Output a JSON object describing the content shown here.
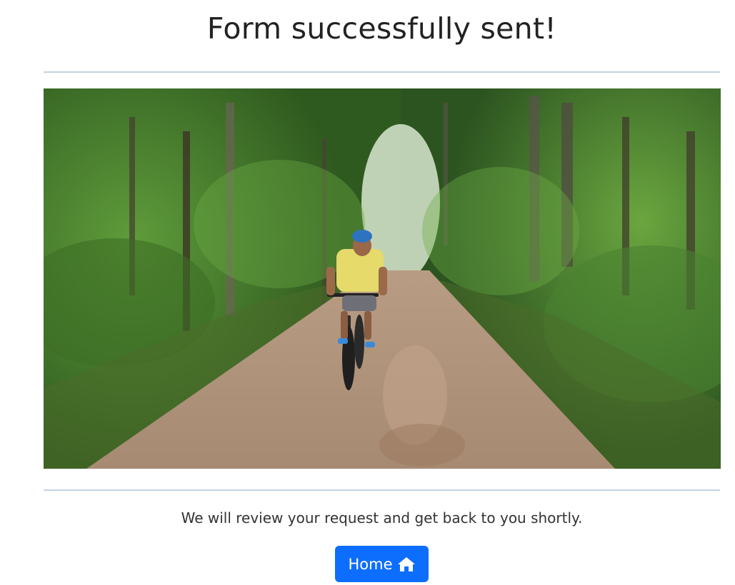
{
  "page": {
    "title": "Form successfully sent!",
    "message": "We will review your request and get back to you shortly."
  },
  "home_button": {
    "label": "Home",
    "icon": "home-icon",
    "color": "#0d6efd"
  },
  "colors": {
    "divider": "#c3d2e3"
  }
}
